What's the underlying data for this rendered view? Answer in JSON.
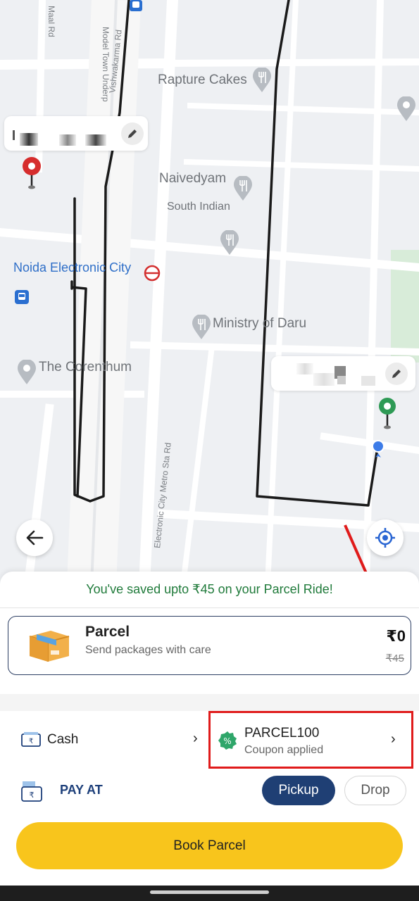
{
  "map": {
    "labels": {
      "maal_rd": "Maal Rd",
      "model_town": "Model Town Underp",
      "vishwakarma": "Vishwakarma Rd",
      "rapture": "Rapture Cakes",
      "naivedyam": "Naivedyam",
      "south_indian": "South Indian",
      "noida": "Noida Electronic City",
      "ministry": "Ministry of Daru",
      "corenthum": "The Corenthum",
      "metro_rd": "Electronic City Metro Sta Rd"
    },
    "icons": {
      "pickup_pin": "red-location-pin",
      "drop_pin": "green-location-pin",
      "current_location": "blue-dot",
      "metro": "metro-station-icon",
      "bus": "bus-stop-icon",
      "restaurant": "fork-knife-icon",
      "place": "place-pin-icon"
    },
    "colors": {
      "pickup": "#d62d2d",
      "drop": "#2e9a55",
      "route": "#1a1a1a"
    }
  },
  "buttons": {
    "back_icon": "arrow-left-icon",
    "locate_icon": "crosshair-icon"
  },
  "sheet": {
    "savings_text": "You've saved upto ₹45 on your Parcel Ride!",
    "service": {
      "name": "Parcel",
      "subtitle": "Send packages with care",
      "price": "₹0",
      "original_price": "₹45",
      "icon": "parcel-box-icon"
    },
    "payment": {
      "method": "Cash",
      "method_icon": "cash-icon",
      "coupon_code": "PARCEL100",
      "coupon_status": "Coupon applied",
      "coupon_icon": "discount-badge-icon"
    },
    "pay_at": {
      "label": "PAY AT",
      "options": [
        "Pickup",
        "Drop"
      ],
      "selected": "Pickup"
    },
    "cta": "Book Parcel"
  },
  "colors": {
    "accent_yellow": "#f8c51c",
    "brand_navy": "#1f3f74",
    "savings_green": "#1f7a3a",
    "highlight_red": "#e01b1b"
  }
}
